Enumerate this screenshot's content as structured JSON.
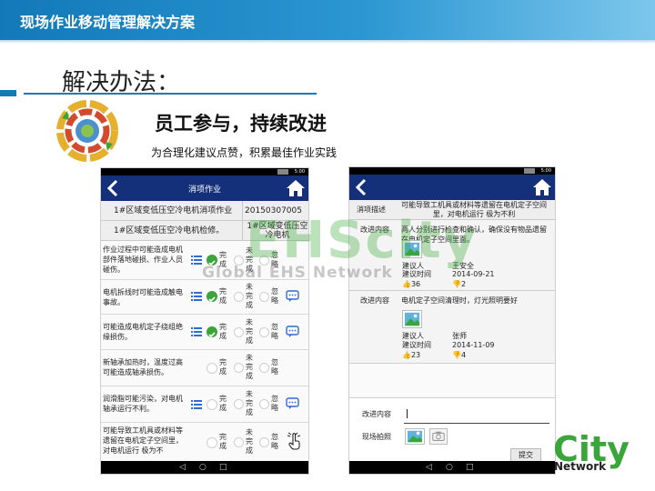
{
  "slide": {
    "title": "现场作业移动管理解决方案",
    "section_title": "解决办法：",
    "headline": "员工参与，持续改进",
    "subline": "为合理化建议点赞，积累最佳作业实践"
  },
  "watermark": {
    "main": "EHScity",
    "sub": "Global EHS Network"
  },
  "brand": {
    "logo_text": "City",
    "logo_sub": "Network"
  },
  "left_phone": {
    "status_time": "5:00",
    "app_title": "消项作业",
    "header_rows": [
      {
        "label": "1#区域变低压空冷电机消项作业",
        "value": "20150307005"
      },
      {
        "label": "1#区域变低压空冷电机检修。",
        "value": "1#区域变低压空冷电机"
      }
    ],
    "tasks": [
      {
        "desc": "作业过程中可能造成电机部件落地碰损、作业人员碰伤。",
        "done_label": "完成",
        "undone_label": "未完成",
        "ignore_label": "忽略",
        "state": "done"
      },
      {
        "desc": "电机拆线时可能造成触电事故。",
        "done_label": "完成",
        "undone_label": "未完成",
        "ignore_label": "忽略",
        "state": "done"
      },
      {
        "desc": "可能造成电机定子绕组绝缘损伤。",
        "done_label": "完成",
        "undone_label": "未完成",
        "ignore_label": "忽略",
        "state": "done"
      },
      {
        "desc": "新轴承加热时，温度过高可能造成轴承损伤。",
        "done_label": "完成",
        "undone_label": "未完成",
        "ignore_label": "忽略",
        "state": "none"
      },
      {
        "desc": "润滑脂可能污染，对电机轴承运行不利。",
        "done_label": "完成",
        "undone_label": "未完成",
        "ignore_label": "忽略",
        "state": "none"
      },
      {
        "desc": "可能导致工机具或材料等遗留在电机定子空间里，对电机运行 极为不",
        "done_label": "完成",
        "undone_label": "未完成",
        "ignore_label": "忽略",
        "state": "none"
      }
    ]
  },
  "right_phone": {
    "status_time": "5:00",
    "desc_label": "消项描述",
    "desc_value": "可能导致工机具或材料等遗留在电机定子空间里，对电机运行 极为不利",
    "suggestions": [
      {
        "label": "改进内容",
        "text": "两人分别进行检查和确认，确保没有物品遗留在电机定子空间里面。",
        "author_label": "建议人",
        "author": "王安全",
        "time_label": "建议时间",
        "time": "2014-09-21",
        "likes": "36",
        "dislikes": "2"
      },
      {
        "label": "改进内容",
        "text": "电机定子空间清理时，灯光照明要好",
        "author_label": "建议人",
        "author": "张师",
        "time_label": "建议时间",
        "time": "2014-11-09",
        "likes": "23",
        "dislikes": "4"
      }
    ],
    "form": {
      "content_label": "改进内容",
      "photo_label": "现场拍照",
      "submit_label": "提交"
    }
  },
  "colors": {
    "title_bar": "#1379b8",
    "app_bar": "#14307a",
    "check_green": "#3aa53a",
    "icon_blue": "#2f6bd6"
  },
  "icons": [
    "back-arrow-icon",
    "home-icon",
    "list-icon",
    "check-icon",
    "comment-icon",
    "tap-hand-icon",
    "image-icon",
    "camera-icon",
    "thumbs-up-icon",
    "thumbs-down-icon"
  ]
}
